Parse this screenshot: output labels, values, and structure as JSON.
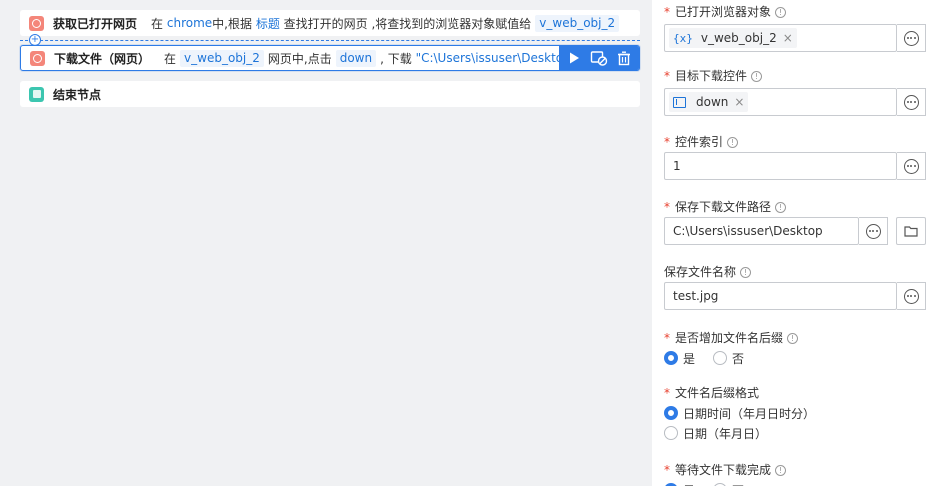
{
  "flow": {
    "node1": {
      "title": "获取已打开网页",
      "parts": [
        "在",
        "chrome",
        "中,根据",
        "标题",
        "查找打开的网页 ,将查找到的浏览器对象赋值给",
        "v_web_obj_2"
      ]
    },
    "node2": {
      "title": "下载文件（网页）",
      "parts": [
        "在",
        "v_web_obj_2",
        "网页中,点击",
        "down",
        ", 下载",
        "\"C:\\Users\\issuser\\Desktop..."
      ]
    },
    "node3": {
      "title": "结束节点"
    },
    "add_symbol": "+"
  },
  "panel": {
    "browser_obj": {
      "label": "已打开浏览器对象",
      "chip_icon": "{x}",
      "value": "v_web_obj_2"
    },
    "target": {
      "label": "目标下载控件",
      "value": "down"
    },
    "index": {
      "label": "控件索引",
      "value": "1"
    },
    "save_path": {
      "label": "保存下载文件路径",
      "value": "C:\\Users\\issuser\\Desktop"
    },
    "file_name": {
      "label": "保存文件名称",
      "value": "test.jpg"
    },
    "add_suffix": {
      "label": "是否增加文件名后缀",
      "options": [
        "是",
        "否"
      ],
      "selected": "是"
    },
    "suffix_format": {
      "label": "文件名后缀格式",
      "options": [
        "日期时间（年月日时分）",
        "日期（年月日）"
      ],
      "selected": "日期时间（年月日时分）"
    },
    "wait": {
      "label": "等待文件下载完成",
      "options": [
        "是",
        "否"
      ],
      "selected": "是"
    }
  },
  "symbols": {
    "required": "*",
    "info": "!",
    "close": "×"
  },
  "icons": [
    "web-node-icon",
    "end-node-icon",
    "play-icon",
    "disable-icon",
    "trash-icon",
    "more-icon",
    "folder-icon",
    "variable-icon",
    "element-icon",
    "info-icon"
  ],
  "colors": {
    "accent": "#2e7be6",
    "required": "#e8402f",
    "web_node": "#f4867a",
    "end_node": "#3cc6b0"
  }
}
